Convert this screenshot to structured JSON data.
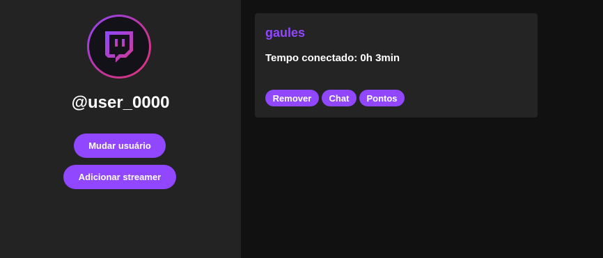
{
  "profile": {
    "avatar_icon": "twitch-glitch-icon",
    "username": "@user_0000",
    "change_user_label": "Mudar usuário",
    "add_streamer_label": "Adicionar streamer"
  },
  "streamers": [
    {
      "name": "gaules",
      "connected_time": "Tempo conectado: 0h 3min",
      "actions": {
        "remove_label": "Remover",
        "chat_label": "Chat",
        "points_label": "Pontos"
      }
    }
  ],
  "colors": {
    "accent": "#9146ff",
    "sidebar_bg": "#232323",
    "main_bg": "#111111",
    "card_bg": "#242424"
  }
}
